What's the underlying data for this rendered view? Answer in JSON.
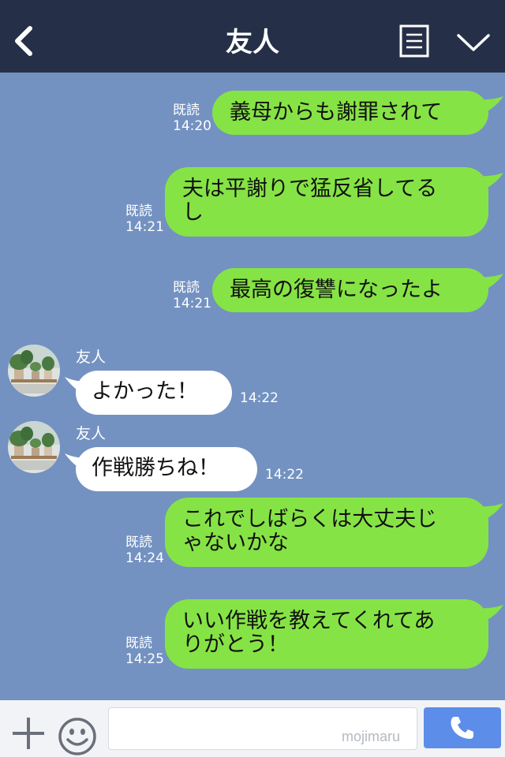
{
  "header": {
    "title": "友人",
    "back_icon": "chevron-left-icon",
    "notes_icon": "notes-icon",
    "menu_icon": "chevron-down-icon"
  },
  "messages": [
    {
      "from": "me",
      "read": "既読",
      "time": "14:20",
      "lines": [
        "義母からも謝罪されて"
      ]
    },
    {
      "from": "me",
      "read": "既読",
      "time": "14:21",
      "lines": [
        "夫は平謝りで猛反省してる",
        "し"
      ]
    },
    {
      "from": "me",
      "read": "既読",
      "time": "14:21",
      "lines": [
        "最高の復讐になったよ"
      ]
    },
    {
      "from": "friend",
      "name": "友人",
      "time": "14:22",
      "lines": [
        "よかった！"
      ]
    },
    {
      "from": "friend",
      "name": "友人",
      "time": "14:22",
      "lines": [
        "作戦勝ちね！"
      ]
    },
    {
      "from": "me",
      "read": "既読",
      "time": "14:24",
      "lines": [
        "これでしばらくは大丈夫じ",
        "ゃないかな"
      ]
    },
    {
      "from": "me",
      "read": "既読",
      "time": "14:25",
      "lines": [
        "いい作戦を教えてくれてあ",
        "りがとう！"
      ]
    }
  ],
  "footer": {
    "input_value": "",
    "watermark": "mojimaru",
    "plus_icon": "plus-icon",
    "emoji_icon": "smile-icon",
    "call_icon": "phone-icon"
  },
  "colors": {
    "background": "#7392c1",
    "header": "#253048",
    "my_bubble": "#86e345",
    "friend_bubble": "#ffffff",
    "call_button": "#5c8de8"
  }
}
